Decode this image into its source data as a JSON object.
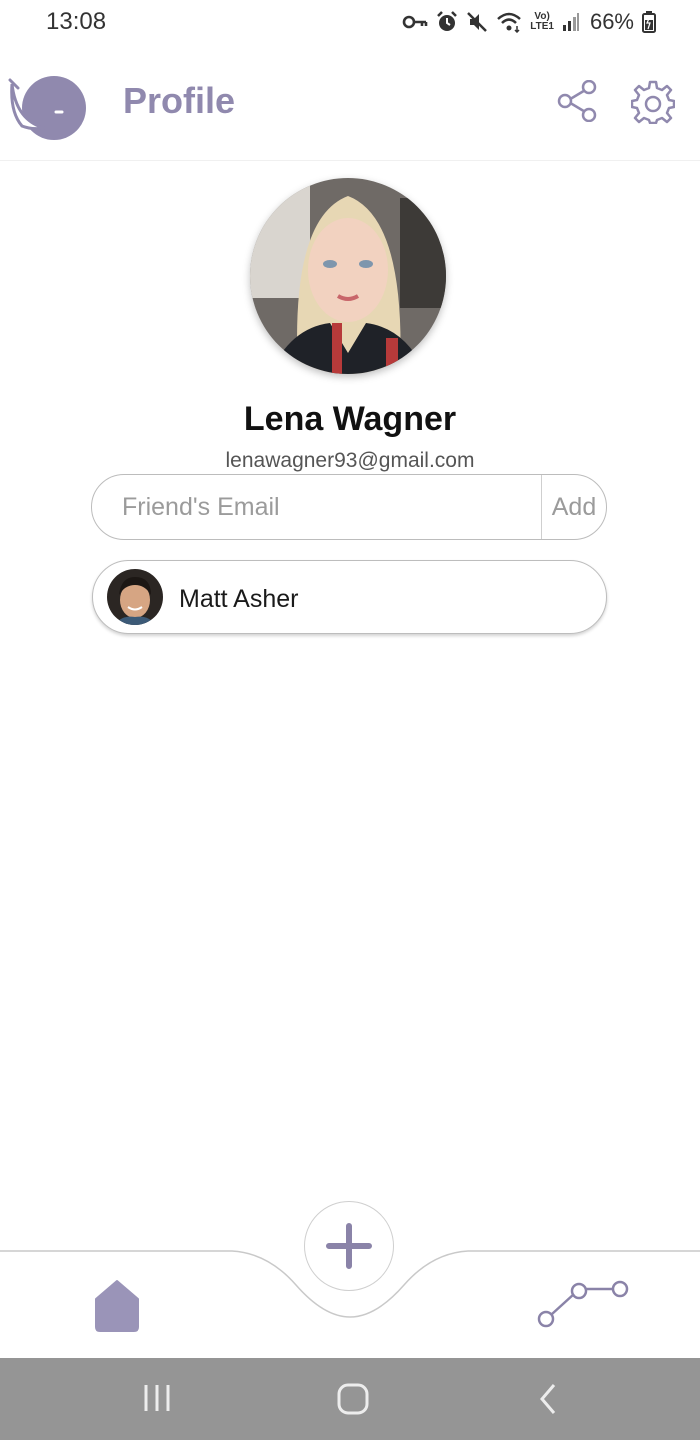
{
  "status_bar": {
    "time": "13:08",
    "battery": "66%",
    "network_top": "Vo)",
    "network_bottom": "LTE1"
  },
  "header": {
    "title": "Profile",
    "icons": [
      "snail-logo-icon",
      "share-icon",
      "gear-icon"
    ]
  },
  "profile": {
    "name": "Lena Wagner",
    "email": "lenawagner93@gmail.com"
  },
  "add_friend": {
    "placeholder": "Friend's Email",
    "value": "",
    "add_label": "Add"
  },
  "friends": [
    {
      "name": "Matt Asher"
    }
  ],
  "bottom_nav": {
    "items": [
      "home-icon",
      "plus-icon",
      "route-icon"
    ]
  },
  "colors": {
    "accent": "#9089ae",
    "system_nav": "#959595"
  }
}
